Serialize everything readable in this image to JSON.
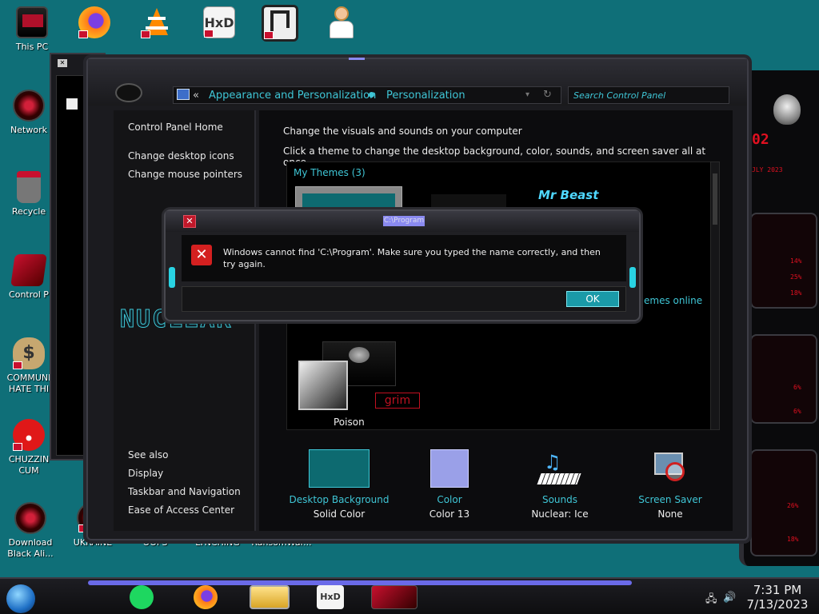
{
  "desktop": {
    "icons": [
      {
        "label": "This PC"
      },
      {
        "label": "Network"
      },
      {
        "label": "Recycle"
      },
      {
        "label": "Control P"
      },
      {
        "label": "COMMUNI HATE THI"
      },
      {
        "label": "CHUZZIN CUM"
      },
      {
        "label": "Download Black Ali..."
      },
      {
        "label": "UKRAINE"
      },
      {
        "label": "OOPS"
      },
      {
        "label": "LYNCHING"
      },
      {
        "label": "RansomWar..."
      }
    ]
  },
  "gadget": {
    "date": "JLY 2023",
    "p1": "14%",
    "p2": "25%",
    "p3": "18%",
    "p4": "6%",
    "p5": "6%",
    "p6": "26%",
    "p7": "18%"
  },
  "control_panel": {
    "address": {
      "back": "«",
      "crumb1": "Appearance and Personalization",
      "crumb2": "Personalization"
    },
    "search_placeholder": "Search Control Panel",
    "left_links": {
      "home": "Control Panel Home",
      "desktop_icons": "Change desktop icons",
      "mouse_pointers": "Change mouse pointers",
      "see_also": "See also",
      "display": "Display",
      "taskbar": "Taskbar and Navigation",
      "ease": "Ease of Access Center"
    },
    "brand": "NUCLEAR",
    "heading": "Change the visuals and sounds on your computer",
    "subheading": "Click a theme to change the desktop background, color, sounds, and screen saver all at once.",
    "my_themes": "My Themes (3)",
    "get_more": "emes online",
    "theme_mrbeast": "Mr Beast",
    "theme_grim": "grim",
    "theme_poison": "Poison",
    "bottom": [
      {
        "title": "Desktop Background",
        "sub": "Solid Color"
      },
      {
        "title": "Color",
        "sub": "Color 13"
      },
      {
        "title": "Sounds",
        "sub": "Nuclear: Ice"
      },
      {
        "title": "Screen Saver",
        "sub": "None"
      }
    ],
    "colors": {
      "accent": "#3fc6d6",
      "swatch_bg": "#0d6a70",
      "swatch_color": "#9aa0e8"
    }
  },
  "dialog": {
    "title": "C:\\Program",
    "message": "Windows cannot find 'C:\\Program'. Make sure you typed the name correctly, and then try again.",
    "ok_label": "OK",
    "close_label": "✕"
  },
  "taskbar": {
    "time": "7:31 PM",
    "date": "7/13/2023"
  }
}
